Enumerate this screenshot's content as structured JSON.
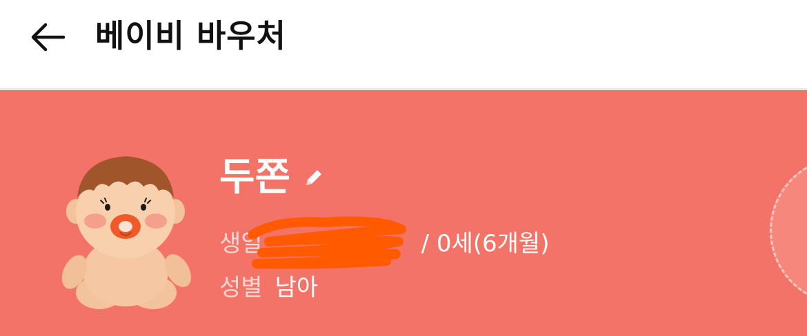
{
  "header": {
    "title": "베이비 바우처",
    "back_icon": "arrow-left-icon"
  },
  "profile": {
    "name": "두쫀",
    "edit_icon": "pencil-icon",
    "birth_label": "생일",
    "birth_value_visible": "/ 0세(6개월)",
    "gender_label": "성별",
    "gender_value": "남아",
    "avatar_icon": "baby-avatar-icon"
  },
  "colors": {
    "card_background": "#f47368",
    "header_text": "#111111",
    "redaction_scribble": "#ff5a00"
  }
}
